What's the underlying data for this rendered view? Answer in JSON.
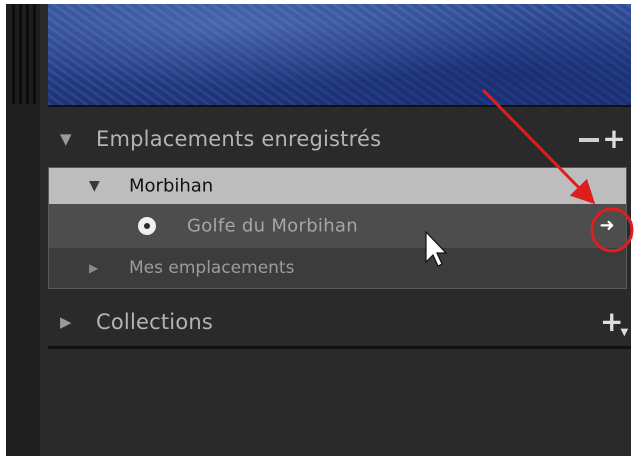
{
  "map": {
    "description_icon": "map-preview"
  },
  "saved_locations": {
    "title": "Emplacements enregistrés",
    "remove_label": "−",
    "add_label": "+",
    "tree": {
      "parent": {
        "label": "Morbihan",
        "expanded": true
      },
      "selected_item": {
        "label": "Golfe du Morbihan",
        "icon": "radio-target-icon",
        "action_icon": "arrow-right-icon"
      },
      "other_folder": {
        "label": "Mes emplacements",
        "expanded": false
      }
    }
  },
  "collections": {
    "title": "Collections",
    "add_label": "+"
  },
  "annotation": {
    "arrow_color": "#e01e1e",
    "circle_color": "#e01e1e"
  },
  "colors": {
    "panel_bg": "#2a2a2a",
    "selected_folder_bg": "#bdbdbd",
    "selected_row_bg": "#4d4d4d",
    "map_blue": "#2a4590"
  }
}
